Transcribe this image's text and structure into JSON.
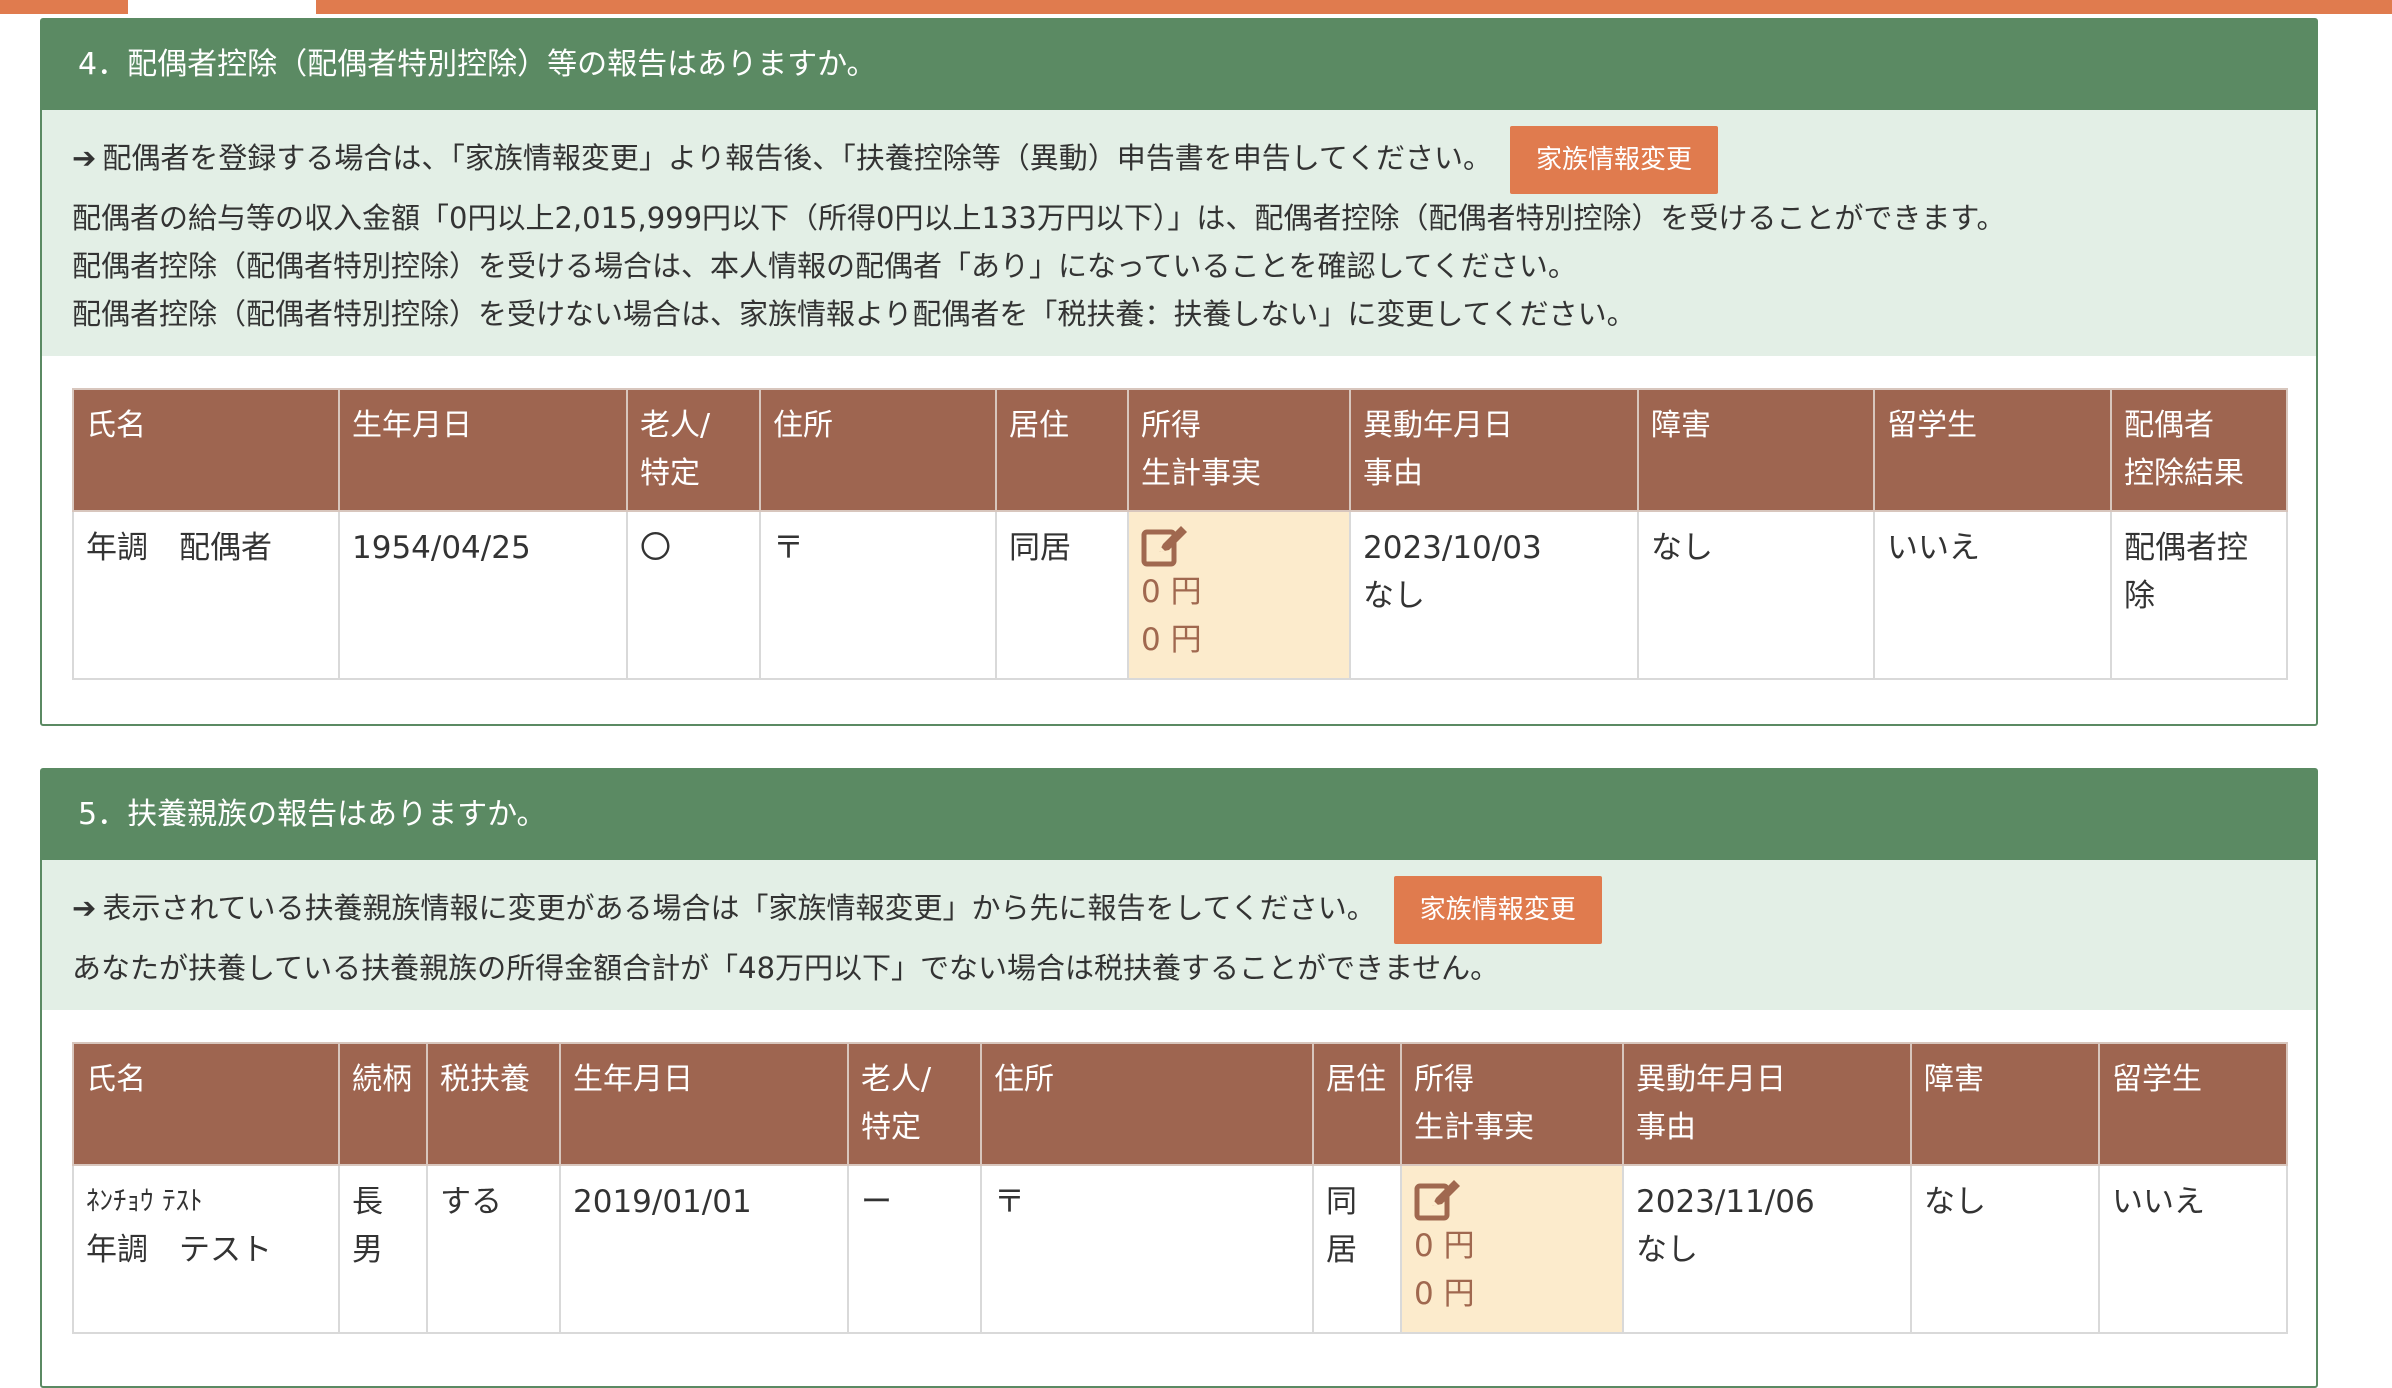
{
  "section4": {
    "title": "4．配偶者控除（配偶者特別控除）等の報告はありますか。",
    "notice_lines": [
      "配偶者を登録する場合は、「家族情報変更」より報告後、「扶養控除等（異動）申告書を申告してください。",
      "配偶者の給与等の収入金額「0円以上2,015,999円以下（所得0円以上133万円以下）」は、配偶者控除（配偶者特別控除）を受けることができます。",
      "配偶者控除（配偶者特別控除）を受ける場合は、本人情報の配偶者「あり」になっていることを確認してください。",
      "配偶者控除（配偶者特別控除）を受けない場合は、家族情報より配偶者を「税扶養：扶養しない」に変更してください。"
    ],
    "button_label": "家族情報変更",
    "table": {
      "headers": [
        "氏名",
        "生年月日",
        "老人/\n特定",
        "住所",
        "居住",
        "所得\n生計事実",
        "異動年月日\n事由",
        "障害",
        "留学生",
        "配偶者\n控除結果"
      ],
      "row": {
        "name": "年調　配偶者",
        "birth": "1954/04/25",
        "elderly": "〇",
        "address": "〒",
        "residence": "同居",
        "income1": "0 円",
        "income2": "0 円",
        "change_date": "2023/10/03",
        "reason": "なし",
        "disability": "なし",
        "student": "いいえ",
        "result": "配偶者控\n除"
      }
    }
  },
  "section5": {
    "title": "5．扶養親族の報告はありますか。",
    "notice_lines": [
      "表示されている扶養親族情報に変更がある場合は「家族情報変更」から先に報告をしてください。",
      "あなたが扶養している扶養親族の所得金額合計が「48万円以下」でない場合は税扶養することができません。"
    ],
    "button_label": "家族情報変更",
    "table": {
      "headers": [
        "氏名",
        "続柄",
        "税扶養",
        "生年月日",
        "老人/\n特定",
        "住所",
        "居住",
        "所得\n生計事実",
        "異動年月日\n事由",
        "障害",
        "留学生"
      ],
      "row": {
        "name_kana": "ﾈﾝﾁｮｳ ﾃｽﾄ",
        "name": "年調　テスト",
        "relation": "長\n男",
        "tax_dependent": "する",
        "birth": "2019/01/01",
        "elderly": "ー",
        "address": "〒",
        "residence": "同\n居",
        "income1": "0 円",
        "income2": "0 円",
        "change_date": "2023/11/06",
        "reason": "なし",
        "disability": "なし",
        "student": "いいえ"
      }
    }
  },
  "icons": {
    "arrow": "arrow-right-icon",
    "edit": "edit-icon"
  },
  "colors": {
    "header_green": "#5b8a63",
    "notice_bg": "#e3efe6",
    "table_header": "#9e6550",
    "button": "#e07b4e",
    "income_bg": "#fcebcc"
  }
}
